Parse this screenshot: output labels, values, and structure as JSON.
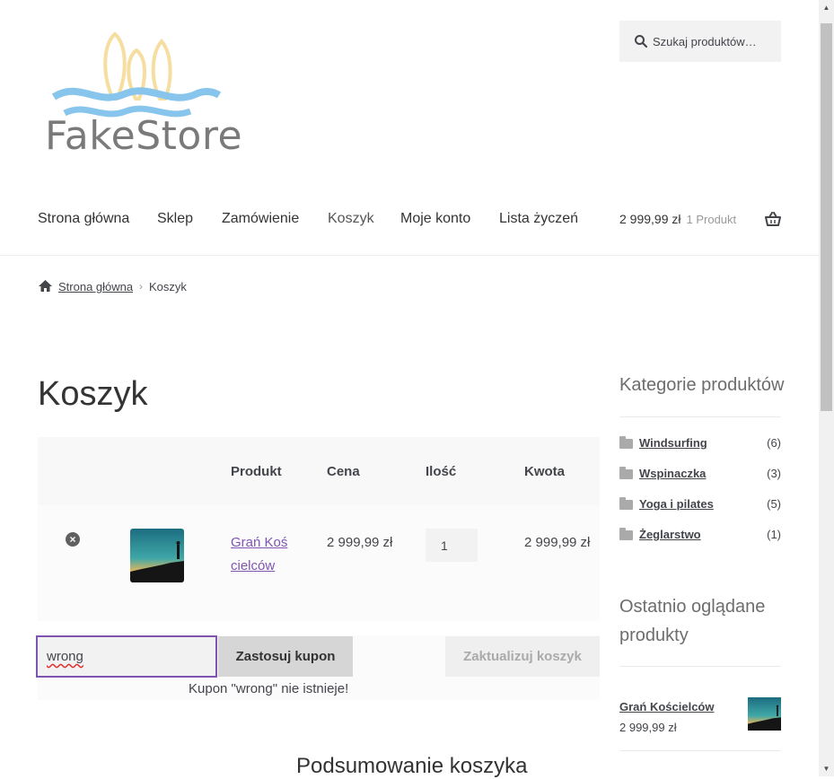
{
  "header": {
    "logo_text": "FakeStore",
    "search_placeholder": "Szukaj produktów…"
  },
  "nav": {
    "items": [
      "Strona główna",
      "Sklep",
      "Zamówienie",
      "Koszyk",
      "Moje konto",
      "Lista życzeń"
    ],
    "cart_amount": "2 999,99 zł",
    "cart_count": "1 Produkt"
  },
  "breadcrumb": {
    "home": "Strona główna",
    "separator": "›",
    "current": "Koszyk"
  },
  "page_title": "Koszyk",
  "cart": {
    "headers": {
      "product": "Produkt",
      "price": "Cena",
      "quantity": "Ilość",
      "total": "Kwota"
    },
    "rows": [
      {
        "product_name": "Grań Kościelców",
        "price": "2 999,99 zł",
        "quantity": "1",
        "total": "2 999,99 zł"
      }
    ],
    "coupon_value": "wrong",
    "apply_coupon_label": "Zastosuj kupon",
    "update_cart_label": "Zaktualizuj koszyk",
    "coupon_error": "Kupon \"wrong\" nie istnieje!",
    "summary_title": "Podsumowanie koszyka"
  },
  "sidebar": {
    "categories_title": "Kategorie produktów",
    "categories": [
      {
        "label": "Windsurfing",
        "count": "(6)"
      },
      {
        "label": "Wspinaczka",
        "count": "(3)"
      },
      {
        "label": "Yoga i pilates",
        "count": "(5)"
      },
      {
        "label": "Żeglarstwo",
        "count": "(1)"
      }
    ],
    "recent_title": "Ostatnio oglądane produkty",
    "recent": [
      {
        "name": "Grań Kościelców",
        "price": "2 999,99 zł"
      }
    ]
  },
  "colors": {
    "accent": "#7f54b3",
    "text": "#43454b",
    "error_underline": "#e0302a"
  },
  "icons": [
    "search-icon",
    "basket-icon",
    "home-icon",
    "remove-icon",
    "folder-icon"
  ]
}
